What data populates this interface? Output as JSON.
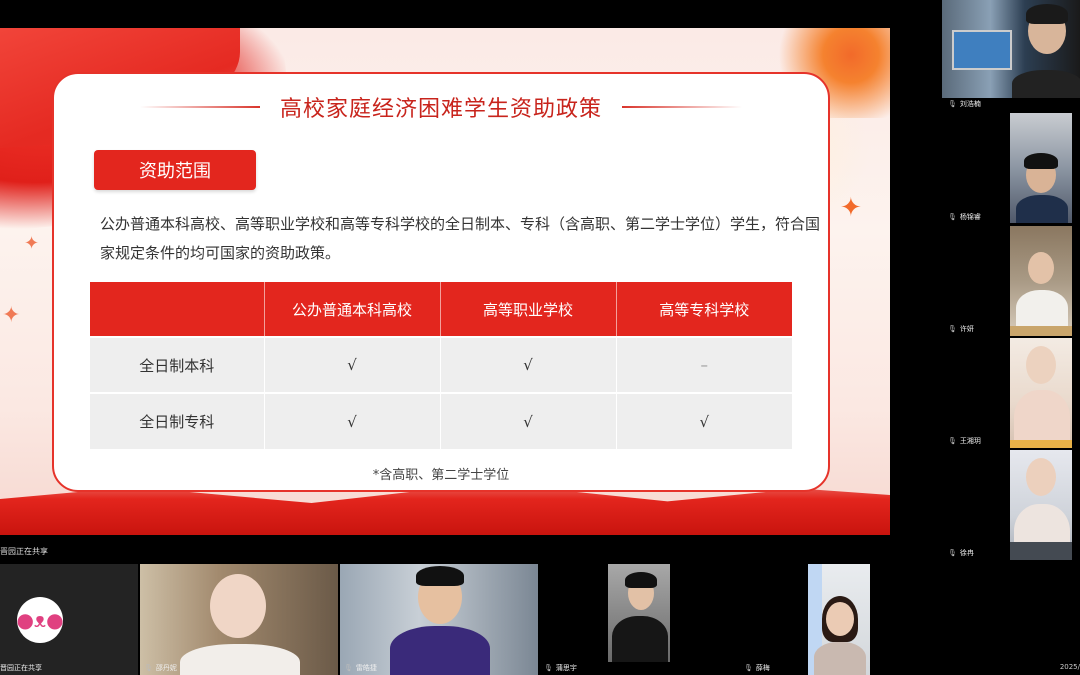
{
  "slide": {
    "title": "高校家庭经济困难学生资助政策",
    "section_label": "资助范围",
    "description": "公办普通本科高校、高等职业学校和高等专科学校的全日制本、专科（含高职、第二学士学位）学生，符合国家规定条件的均可国家的资助政策。",
    "table": {
      "headers": [
        "",
        "公办普通本科高校",
        "高等职业学校",
        "高等专科学校"
      ],
      "rows": [
        [
          "全日制本科",
          "√",
          "√",
          "–"
        ],
        [
          "全日制专科",
          "√",
          "√",
          "√"
        ]
      ]
    },
    "footnote": "*含高职、第二学士学位"
  },
  "share_status": "晋园正在共享",
  "participants_right": [
    {
      "name": "刘浩楠"
    },
    {
      "name": "杨锦睿"
    },
    {
      "name": "许妍"
    },
    {
      "name": "王湘玥"
    },
    {
      "name": "徐冉"
    }
  ],
  "participants_bottom": [
    {
      "name": "晋园正在共享"
    },
    {
      "name": "邵丹妮"
    },
    {
      "name": "雷皓捷"
    },
    {
      "name": "蒲思宇"
    },
    {
      "name": "薛梅"
    }
  ],
  "clock": "2025/",
  "colors": {
    "accent": "#e3261e",
    "title": "#c8241c",
    "table_row_bg": "#eeeeee"
  }
}
